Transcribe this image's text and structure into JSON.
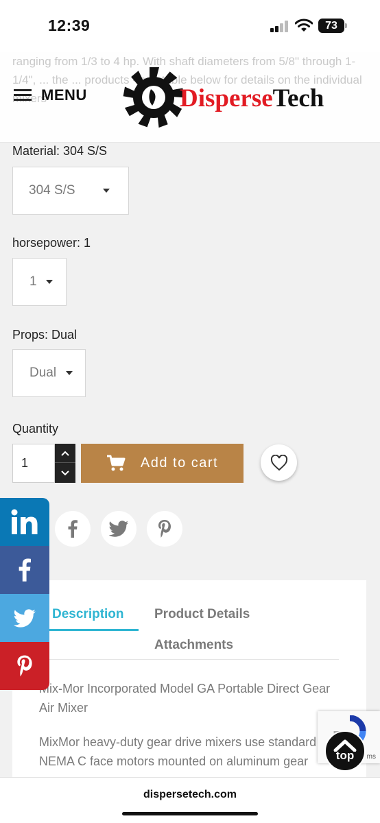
{
  "status_bar": {
    "time": "12:39",
    "battery": "73"
  },
  "header": {
    "menu_label": "MENU",
    "logo_part1": "Disperse",
    "logo_part2": "Tech",
    "background_text": "ranging from 1/3 to 4 hp. With shaft diameters from 5/8\" through 1-1/4\", ... the ... products - see table below for details on the individual mixers"
  },
  "product_form": {
    "material": {
      "label": "Material: 304 S/S",
      "value": "304 S/S"
    },
    "horsepower": {
      "label": "horsepower: 1",
      "value": "1"
    },
    "props": {
      "label": "Props: Dual",
      "value": "Dual"
    },
    "quantity": {
      "label": "Quantity",
      "value": "1"
    },
    "add_to_cart": "Add to cart"
  },
  "tabs": {
    "items": [
      {
        "label": "Description",
        "active": true
      },
      {
        "label": "Product Details",
        "active": false
      },
      {
        "label": "Attachments",
        "active": false
      }
    ]
  },
  "description": {
    "title": "Mix-Mor Incorporated Model GA Portable Direct Gear Air Mixer",
    "body": "MixMor heavy-duty gear drive mixers use standard NEMA C face motors mounted on aluminum gear"
  },
  "recaptcha": {
    "terms": "ms"
  },
  "top_button": {
    "label": "top"
  },
  "url_bar": {
    "url": "dispersetech.com"
  },
  "colors": {
    "accent": "#2fb5d2",
    "add_to_cart": "#b98447",
    "linkedin": "#0a78b5",
    "facebook": "#3c5a99",
    "twitter": "#4ca8e0",
    "pinterest": "#cb2027",
    "logo_red": "#e21b23"
  },
  "icons": [
    "linkedin-icon",
    "facebook-icon",
    "twitter-icon",
    "pinterest-icon",
    "cart-icon",
    "heart-icon",
    "chevron-up-icon",
    "chevron-down-icon",
    "hamburger-icon"
  ]
}
